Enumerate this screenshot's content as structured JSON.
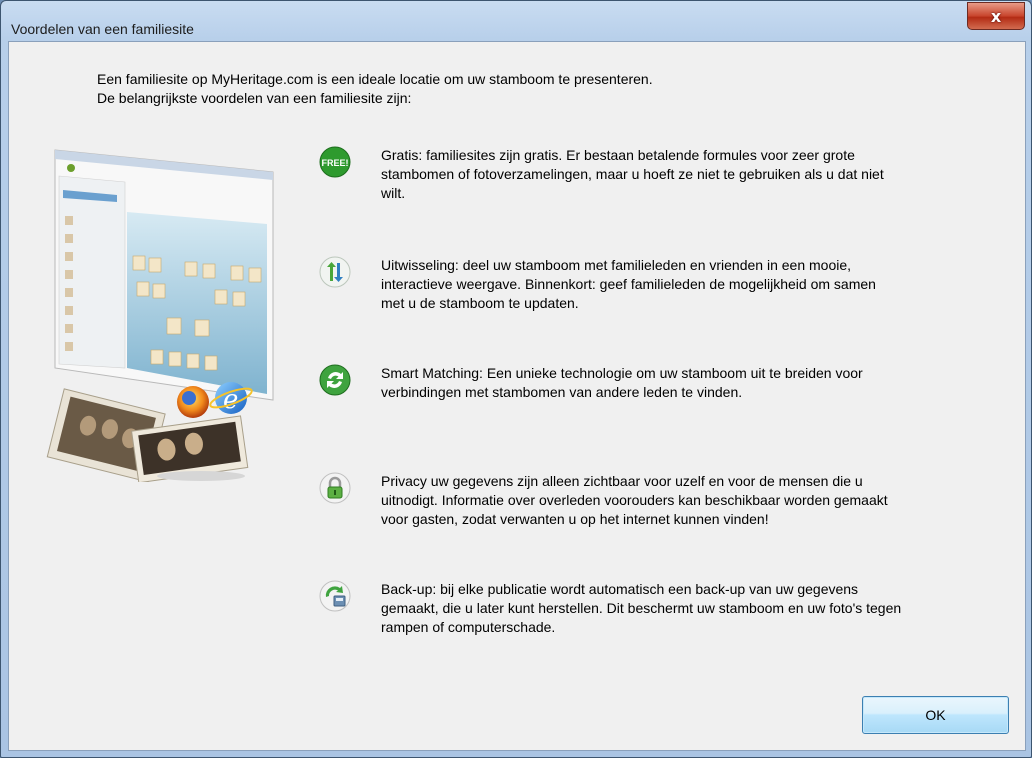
{
  "window": {
    "title": "Voordelen van een familiesite",
    "close_glyph": "x"
  },
  "intro": {
    "line1": "Een familiesite op MyHeritage.com is een ideale locatie om uw stamboom te presenteren.",
    "line2": "De belangrijkste voordelen van een familiesite zijn:"
  },
  "benefits": [
    {
      "icon": "free-badge-icon",
      "badge": "FREE!",
      "lines": [
        "Gratis: familiesites zijn gratis. Er bestaan betalende formules voor zeer grote",
        "stambomen of fotoverzamelingen, maar u hoeft ze niet te gebruiken als u dat niet",
        "wilt."
      ]
    },
    {
      "icon": "exchange-arrows-icon",
      "lines": [
        "Uitwisseling: deel uw stamboom met familieleden en vrienden in een mooie,",
        "interactieve weergave. Binnenkort: geef familieleden de mogelijkheid om samen",
        "met u de stamboom te updaten."
      ]
    },
    {
      "icon": "smart-matching-icon",
      "lines": [
        "Smart Matching: Een unieke technologie om uw stamboom uit te breiden voor",
        "verbindingen met stambomen van andere leden te vinden."
      ]
    },
    {
      "icon": "privacy-lock-icon",
      "lines": [
        "Privacy uw gegevens zijn alleen zichtbaar voor uzelf en voor de mensen die u",
        "uitnodigt. Informatie over overleden voorouders kan beschikbaar worden gemaakt",
        "voor gasten, zodat verwanten u op het internet kunnen vinden!"
      ]
    },
    {
      "icon": "backup-icon",
      "lines": [
        "Back-up: bij elke publicatie wordt automatisch een back-up van uw gegevens",
        "gemaakt, die u later kunt herstellen. Dit beschermt uw stamboom en uw foto's tegen",
        "rampen of computerschade."
      ]
    }
  ],
  "buttons": {
    "ok_label": "OK"
  },
  "colors": {
    "title_bar": "#b7cfea",
    "client_bg": "#f0f0f0",
    "close_red": "#c8452c",
    "icon_green": "#2e9a2e",
    "ok_border": "#3c7fb1"
  }
}
